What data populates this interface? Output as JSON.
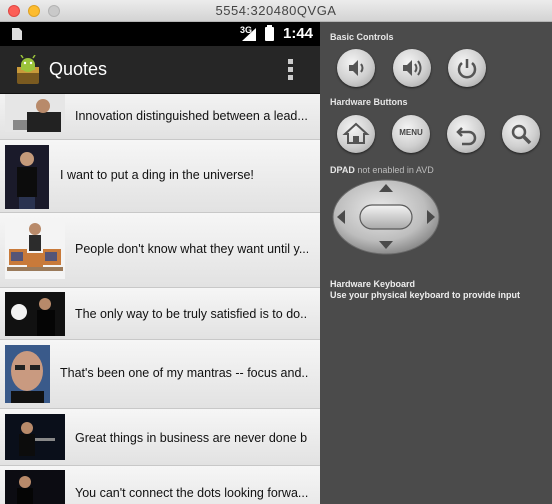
{
  "window": {
    "title": "5554:320480QVGA"
  },
  "statusbar": {
    "network": "3G",
    "time": "1:44"
  },
  "app": {
    "title": "Quotes"
  },
  "quotes": [
    {
      "text": "Innovation distinguished between a lead..."
    },
    {
      "text": "I want to put a ding in the universe!"
    },
    {
      "text": "People don't know what they want until y..."
    },
    {
      "text": "The only way to be truly satisfied is to do..."
    },
    {
      "text": "That's been one of my mantras -- focus and..."
    },
    {
      "text": "Great things in business are never done b..."
    },
    {
      "text": "You can't connect the dots looking forwa..."
    }
  ],
  "controls": {
    "basic_title": "Basic Controls",
    "hardware_title": "Hardware Buttons",
    "menu_label": "MENU",
    "dpad_title": "DPAD",
    "dpad_note": "not enabled in AVD",
    "keyboard_title": "Hardware Keyboard",
    "keyboard_note": "Use your physical keyboard to provide input"
  },
  "icons": {
    "basic": [
      "volume-down-icon",
      "volume-up-icon",
      "power-icon"
    ],
    "hardware": [
      "home-icon",
      "menu-button",
      "back-icon",
      "search-icon"
    ]
  }
}
